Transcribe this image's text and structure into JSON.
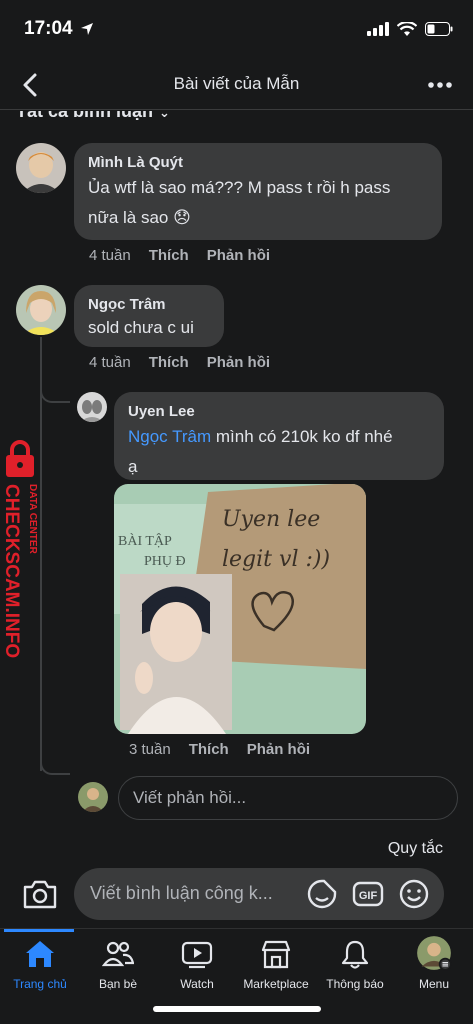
{
  "status": {
    "time": "17:04"
  },
  "header": {
    "title": "Bài viết của Mẫn"
  },
  "filter": {
    "label": "Tất cả bình luận"
  },
  "comments": [
    {
      "author": "Mình Là Quýt",
      "text_line1": "Ủa wtf là sao má??? M pass t rồi h pass",
      "text_line2": "nữa là sao 😞",
      "time": "4 tuần",
      "like": "Thích",
      "reply": "Phản hồi"
    },
    {
      "author": "Ngọc Trâm",
      "text": "sold chưa c ui",
      "time": "4 tuần",
      "like": "Thích",
      "reply": "Phản hồi"
    }
  ],
  "reply": {
    "author": "Uyen Lee",
    "mention": "Ngọc Trâm",
    "text_line1": " mình có 210k ko df nhé",
    "text_line2": "ạ",
    "time": "3 tuần",
    "like": "Thích",
    "reply": "Phản hồi",
    "photo": {
      "sign_text_1": "Uyen lee",
      "sign_text_2": "legit vl :))",
      "book_text_1": "BÀI TẬP",
      "book_text_2": "PHỤ Đ"
    }
  },
  "reply_input": {
    "placeholder": "Viết phản hồi..."
  },
  "watermark": {
    "brand": "CHECKSCAM.INFO",
    "sub": "DATA CENTER"
  },
  "rules": {
    "label": "Quy tắc"
  },
  "comment_input": {
    "placeholder": "Viết bình luận công k..."
  },
  "tabs": [
    {
      "label": "Trang chủ",
      "icon": "home-icon",
      "active": true
    },
    {
      "label": "Bạn bè",
      "icon": "friends-icon"
    },
    {
      "label": "Watch",
      "icon": "watch-icon"
    },
    {
      "label": "Marketplace",
      "icon": "marketplace-icon"
    },
    {
      "label": "Thông báo",
      "icon": "bell-icon"
    },
    {
      "label": "Menu",
      "icon": "menu-avatar-icon"
    }
  ],
  "colors": {
    "accent": "#2d88ff",
    "mention": "#4599ff",
    "bubble": "#3a3b3c",
    "background": "#18191a",
    "watermark": "#e0202a"
  }
}
